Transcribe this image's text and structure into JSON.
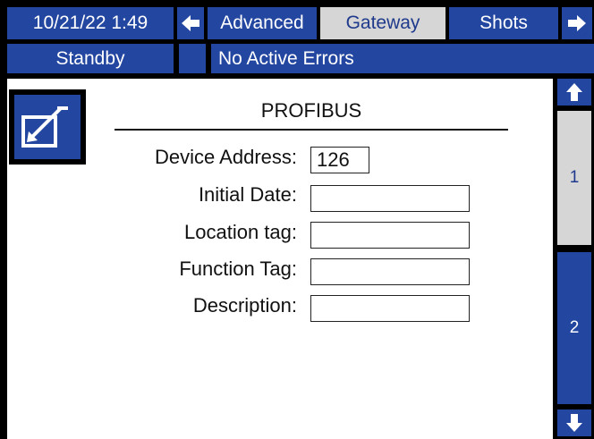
{
  "header": {
    "datetime": "10/21/22 1:49",
    "tabs": [
      {
        "label": "Advanced",
        "active": false
      },
      {
        "label": "Gateway",
        "active": true
      },
      {
        "label": "Shots",
        "active": false
      }
    ],
    "prev_icon": "arrow-left-icon",
    "next_icon": "arrow-right-icon"
  },
  "status": {
    "mode": "Standby",
    "errors": "No Active Errors"
  },
  "main": {
    "edit_icon": "edit-icon",
    "section_title": "PROFIBUS",
    "fields": [
      {
        "label": "Device Address:",
        "value": "126"
      },
      {
        "label": "Initial Date:",
        "value": ""
      },
      {
        "label": "Location tag:",
        "value": ""
      },
      {
        "label": "Function Tag:",
        "value": ""
      },
      {
        "label": "Description:",
        "value": ""
      }
    ]
  },
  "pager": {
    "up_icon": "arrow-up-icon",
    "down_icon": "arrow-down-icon",
    "pages": [
      {
        "label": "1",
        "active": true
      },
      {
        "label": "2",
        "active": false
      }
    ]
  },
  "colors": {
    "accent": "#2346a0",
    "selected": "#d6d6d6",
    "text_on_accent": "#ffffff",
    "text_on_selected": "#1f3a8c"
  }
}
